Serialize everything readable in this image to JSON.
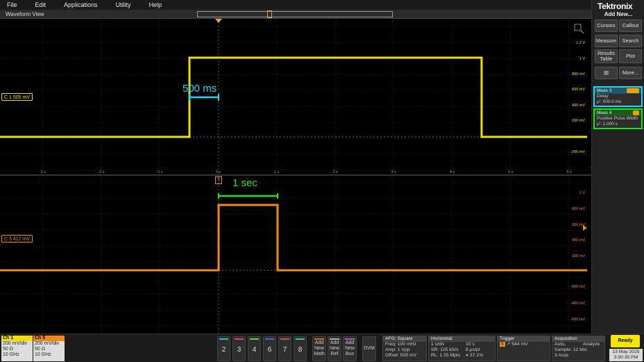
{
  "menu": [
    "File",
    "Edit",
    "Applications",
    "Utility",
    "Help"
  ],
  "waveform_view": {
    "title": "Waveform View"
  },
  "axis": {
    "time_ticks": [
      "-3 s",
      "-2 s",
      "-1 s",
      "0 s",
      "1 s",
      "2 s",
      "3 s",
      "4 s",
      "5 s",
      "6 s"
    ],
    "upper_volt_ticks": [
      "1.2 V",
      "1 V",
      "800 mV",
      "600 mV",
      "400 mV",
      "200 mV",
      "-200 mV"
    ],
    "lower_volt_ticks": [
      "1 V",
      "800 mV",
      "600 mV",
      "400 mV",
      "200 mV",
      "-200 mV",
      "-400 mV",
      "-600 mV"
    ]
  },
  "channels": {
    "ch1_badge": "C 1",
    "ch1_offset": "505 mV",
    "ch5_badge": "C 5",
    "ch5_offset": "417 mV"
  },
  "annotations": {
    "delay_label": "500 ms",
    "width_label": "1 sec"
  },
  "trigger_marker": "T",
  "right_panel": {
    "logo": "Tektronix",
    "add_new": "Add New...",
    "buttons": {
      "cursors": "Cursors",
      "callout": "Callout",
      "measure": "Measure",
      "search": "Search",
      "results_table": "Results Table",
      "plot": "Plot",
      "more": "More..."
    },
    "meas3": {
      "title": "Meas 3",
      "name": "Delay",
      "value": "μ': 500.0 ms"
    },
    "meas4": {
      "title": "Meas 4",
      "name": "Positive Pulse Width",
      "value": "μ': 1.000 s"
    }
  },
  "bottom": {
    "ch1": {
      "label": "Ch 1",
      "scale": "200 mV/div",
      "impedance": "50 Ω",
      "bandwidth": "10 GHz"
    },
    "ch5": {
      "label": "Ch 5",
      "scale": "200 mV/div",
      "impedance": "50 Ω",
      "bandwidth": "10 GHz"
    },
    "num_buttons": [
      "2",
      "3",
      "4",
      "6",
      "7",
      "8"
    ],
    "add_buttons": [
      {
        "l1": "Add",
        "l2": "New",
        "l3": "Math"
      },
      {
        "l1": "Add",
        "l2": "New",
        "l3": "Ref"
      },
      {
        "l1": "Add",
        "l2": "New",
        "l3": "Bus"
      }
    ],
    "dvm": "DVM",
    "afg": {
      "title": "AFG: Square",
      "freq": "Freq: 100 mHz",
      "amp": "Amp: 1 Vpp",
      "offset": "Offset: 500 mV"
    },
    "horizontal": {
      "title": "Horizontal",
      "scale": "1 s/div",
      "duration": "10 s",
      "sr": "SR: 125 kS/s",
      "ptpt": "8 μs/pt",
      "rl": "RL: 1.25 Mpts",
      "pos": "37.1%"
    },
    "trigger": {
      "title": "Trigger",
      "source": "5",
      "level": "544 mV"
    },
    "acquisition": {
      "title": "Acquisition",
      "mode": "Auto,",
      "analyze": "Analyze",
      "sample": "Sample: 12 bits",
      "acqs": "3 Acqs"
    },
    "status": "Ready",
    "date": "13 May 2025",
    "time": "3:30:35 PM"
  },
  "colors": {
    "ch1": "#f0e000",
    "ch5": "#f08a10",
    "cyan": "#20d8f0",
    "green": "#20e020",
    "grid": "#3a3a3a"
  }
}
